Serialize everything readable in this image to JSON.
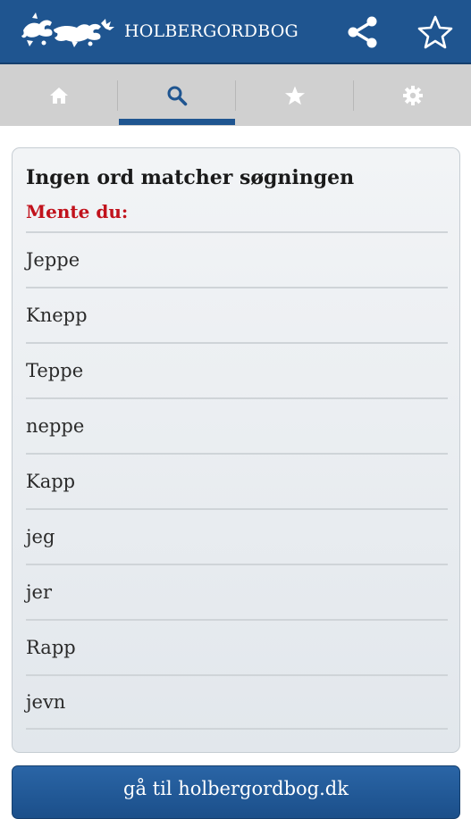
{
  "header": {
    "app_title": "HOLBERGORDBOG",
    "logo_icon": "danish-lions-logo-icon",
    "share_icon": "share-icon",
    "favorite_icon": "star-outline-icon"
  },
  "tabs": [
    {
      "icon": "home-icon",
      "selected": false
    },
    {
      "icon": "search-icon",
      "selected": true
    },
    {
      "icon": "star-icon",
      "selected": false
    },
    {
      "icon": "gear-icon",
      "selected": false
    }
  ],
  "results": {
    "title": "Ingen ord matcher søgningen",
    "subtitle": "Mente du:",
    "suggestions": [
      "Jeppe",
      "Knepp",
      "Teppe",
      "neppe",
      "Kapp",
      "jeg",
      "jer",
      "Rapp",
      "jevn"
    ]
  },
  "footer": {
    "goto_label": "gå til holbergordbog.dk"
  },
  "colors": {
    "brand_blue": "#1f5590",
    "accent_red": "#c1121c",
    "tab_bar": "#d0d0d0"
  }
}
